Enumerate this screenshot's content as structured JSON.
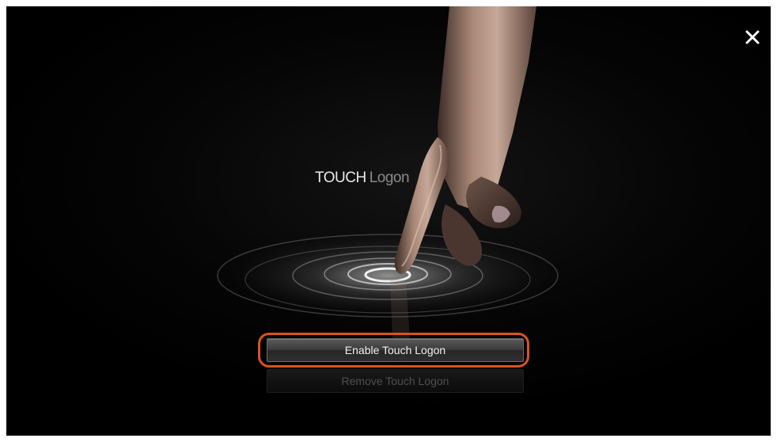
{
  "title": {
    "strong": "TOUCH",
    "light": "Logon"
  },
  "buttons": {
    "enable_label": "Enable Touch Logon",
    "remove_label": "Remove Touch Logon"
  },
  "icons": {
    "close": "close-icon",
    "hero": "touch-finger-ripple-illustration"
  },
  "colors": {
    "background": "#000000",
    "highlight": "#d9541c",
    "title_strong": "#e9e9e9",
    "title_light": "#8a8a8a"
  }
}
